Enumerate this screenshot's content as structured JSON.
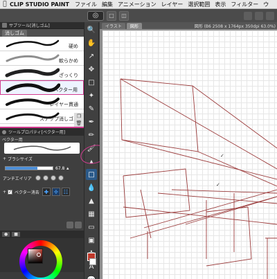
{
  "menubar": {
    "app_name": "CLIP STUDIO PAINT",
    "items": [
      "ファイル",
      "編集",
      "アニメーション",
      "レイヤー",
      "選択範囲",
      "表示",
      "フィルター",
      "ウ"
    ]
  },
  "subtool": {
    "panel_title": "サブツール[消しゴム]",
    "tab_label": "消しゴム",
    "brushes": [
      {
        "label": "硬め"
      },
      {
        "label": "軟らかめ"
      },
      {
        "label": "ざっくり"
      },
      {
        "label": "ベクター用",
        "selected": true
      },
      {
        "label": "レイヤー貫通"
      },
      {
        "label": "スナップ消しゴム"
      }
    ]
  },
  "tool_property": {
    "panel_title": "ツールプロパティ[ベクター用]",
    "subtool_name": "ベクター用",
    "brush_size_label": "ブラシサイズ",
    "brush_size_value": "67.8",
    "brush_size_fraction": 0.68,
    "antialias_label": "アンチエイリア",
    "vector_erase_label": "ベクター消去"
  },
  "document": {
    "tabs": [
      "イラスト",
      "図形"
    ],
    "info": "図形 (B6 2508 x 1764px 350dpi 63.0%)"
  },
  "colors": {
    "accent": "#d23b8f",
    "canvas_line": "#9b3b3b",
    "main_color": "#c0392b"
  }
}
